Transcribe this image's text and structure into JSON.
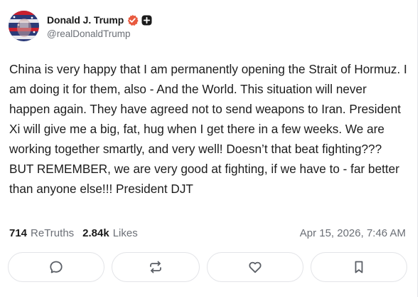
{
  "author": {
    "display_name": "Donald J. Trump",
    "handle": "@realDonaldTrump",
    "avatar_icon": "avatar-flag-portrait",
    "verified_icon": "verified-badge-icon",
    "verified_color": "#e85a3f",
    "plus_icon": "plus-badge-icon"
  },
  "post": {
    "text": "China is very happy that I am permanently opening the Strait of Hormuz. I am doing it for them, also - And the World. This situation will never happen again. They have agreed not to send weapons to Iran. President Xi will give me a big, fat, hug when I get there in a few weeks. We are working together smartly, and very well! Doesn’t that beat fighting??? BUT REMEMBER, we are very good at fighting, if we have to - far better than anyone else!!! President DJT"
  },
  "stats": {
    "retruths_count": "714",
    "retruths_label": "ReTruths",
    "likes_count": "2.84k",
    "likes_label": "Likes",
    "timestamp": "Apr 15, 2026, 7:46 AM"
  },
  "actions": [
    {
      "icon": "reply-icon"
    },
    {
      "icon": "retruth-icon"
    },
    {
      "icon": "like-icon"
    },
    {
      "icon": "bookmark-icon"
    }
  ]
}
